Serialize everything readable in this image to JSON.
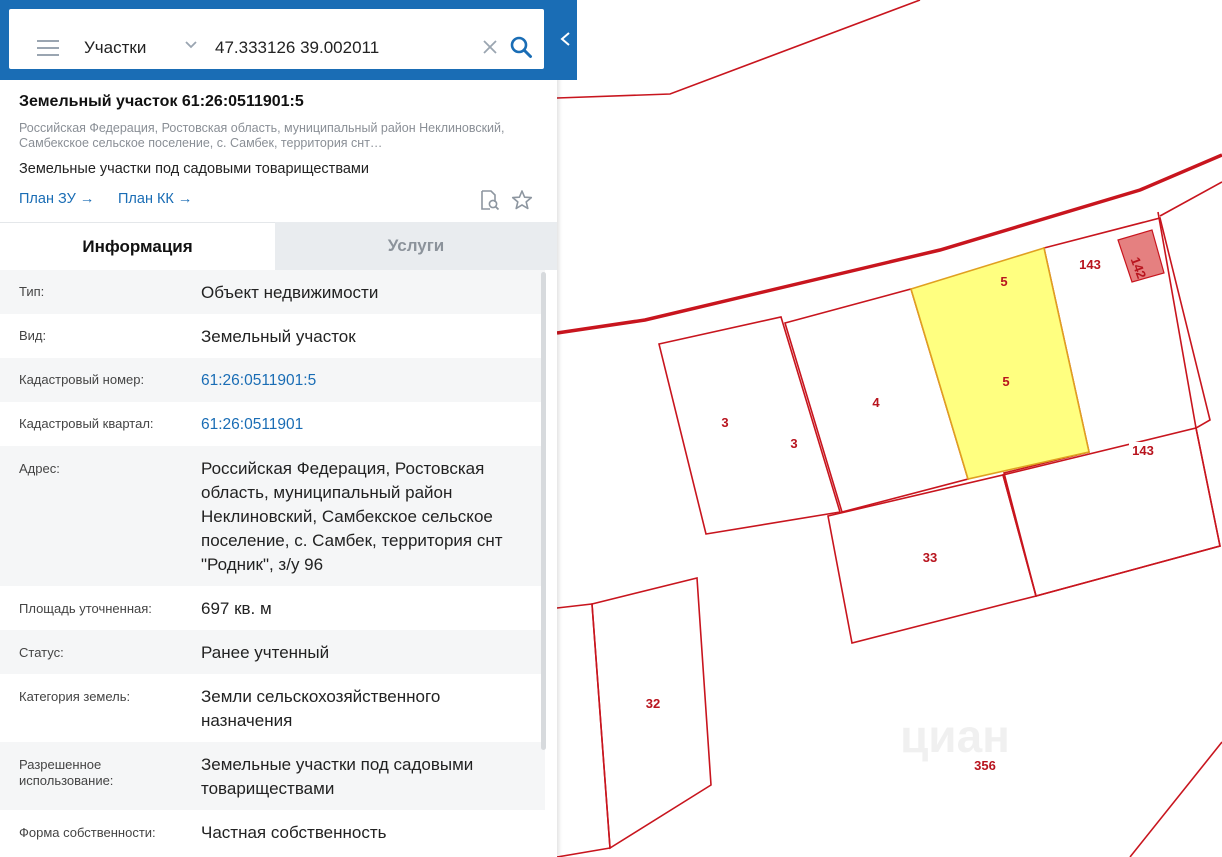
{
  "search": {
    "layer": "Участки",
    "query": "47.333126 39.002011"
  },
  "card": {
    "title": "Земельный участок 61:26:0511901:5",
    "address_short": "Российская Федерация, Ростовская область, муниципальный район Неклиновский, Самбекское сельское поселение, с. Самбек, территория снт…",
    "purpose": "Земельные участки под садовыми товариществами",
    "link_zu": "План ЗУ →",
    "link_kk": "План КК →"
  },
  "tabs": {
    "info": "Информация",
    "services": "Услуги"
  },
  "details": [
    {
      "label": "Тип:",
      "value": "Объект недвижимости"
    },
    {
      "label": "Вид:",
      "value": "Земельный участок"
    },
    {
      "label": "Кадастровый номер:",
      "value": "61:26:0511901:5"
    },
    {
      "label": "Кадастровый квартал:",
      "value": "61:26:0511901"
    },
    {
      "label": "Адрес:",
      "value": "Российская Федерация, Ростовская область, муниципальный район Неклиновский, Самбекское сельское поселение, с. Самбек, территория снт \"Родник\", з/у 96"
    },
    {
      "label": "Площадь уточненная:",
      "value": "697 кв. м"
    },
    {
      "label": "Статус:",
      "value": "Ранее учтенный"
    },
    {
      "label": "Категория земель:",
      "value": "Земли сельскохозяйственного назначения"
    },
    {
      "label": "Разрешенное использование:",
      "value": "Земельные участки под садовыми товариществами"
    },
    {
      "label": "Форма собственности:",
      "value": "Частная собственность"
    }
  ],
  "map": {
    "plot_labels": [
      "5",
      "5",
      "143",
      "142",
      "4",
      "3",
      "3",
      "143",
      "33",
      "32",
      "356"
    ],
    "watermark": "циан"
  },
  "colors": {
    "accent": "#1a6db5",
    "selected_plot": "#ffff80",
    "boundary": "#c8151e"
  }
}
